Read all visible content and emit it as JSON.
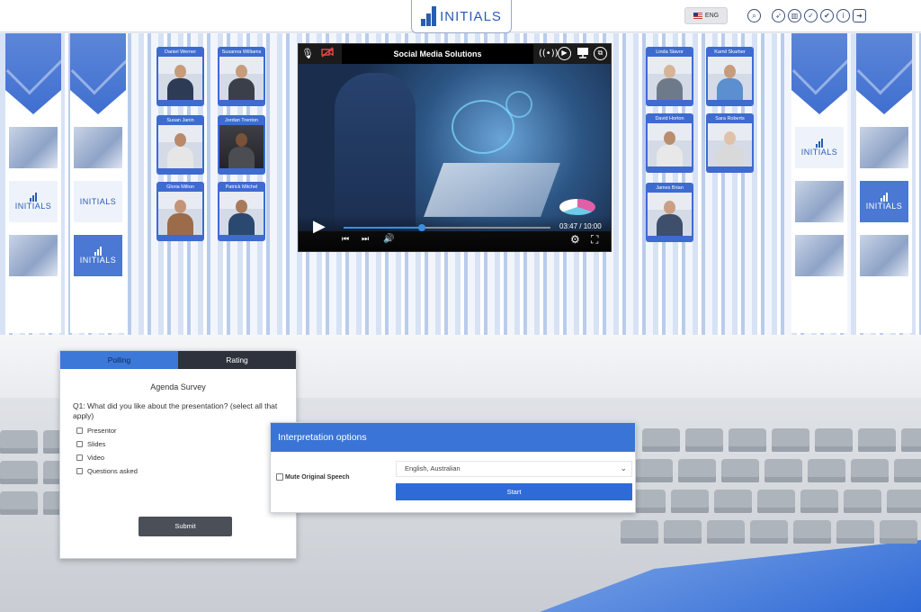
{
  "header": {
    "logo_text": "INITIALS",
    "language_label": "ENG",
    "icons": [
      "search-icon",
      "navigate-icon",
      "poll-icon",
      "checkmark-icon",
      "info-icon",
      "logout-icon"
    ]
  },
  "stage_banners": {
    "logo_text": "INITIALS"
  },
  "participants_left": [
    {
      "name": "Daniel Werner"
    },
    {
      "name": "Susanna Williams"
    },
    {
      "name": "Susan Janin"
    },
    {
      "name": "Jordan Trenton"
    },
    {
      "name": "Gloria Milton"
    },
    {
      "name": "Patrick Mitchel"
    }
  ],
  "participants_right": [
    {
      "name": "Linda Slavor"
    },
    {
      "name": "Kamil Skarber"
    },
    {
      "name": "David Horton"
    },
    {
      "name": "Sara Roberts"
    },
    {
      "name": "James Brian"
    }
  ],
  "player": {
    "title": "Social Media Solutions",
    "current_time": "03:47",
    "duration": "10:00",
    "time_display": "03:47 / 10:00",
    "progress": 0.378
  },
  "poll": {
    "tabs": [
      {
        "label": "Polling",
        "active": true
      },
      {
        "label": "Rating",
        "active": false
      }
    ],
    "title": "Agenda Survey",
    "question": "Q1: What did you like about the presentation? (select all that apply)",
    "options": [
      {
        "label": "Presentor",
        "checked": false
      },
      {
        "label": "Slides",
        "checked": false
      },
      {
        "label": "Video",
        "checked": false
      },
      {
        "label": "Questions asked",
        "checked": false
      }
    ],
    "submit_label": "Submit"
  },
  "interpretation": {
    "title": "Interpretation options",
    "mute_label": "Mute Original Speech",
    "mute_checked": false,
    "selected_language": "English, Australian",
    "start_label": "Start"
  },
  "colors": {
    "accent": "#3a74d6",
    "dark": "#2d323c"
  }
}
